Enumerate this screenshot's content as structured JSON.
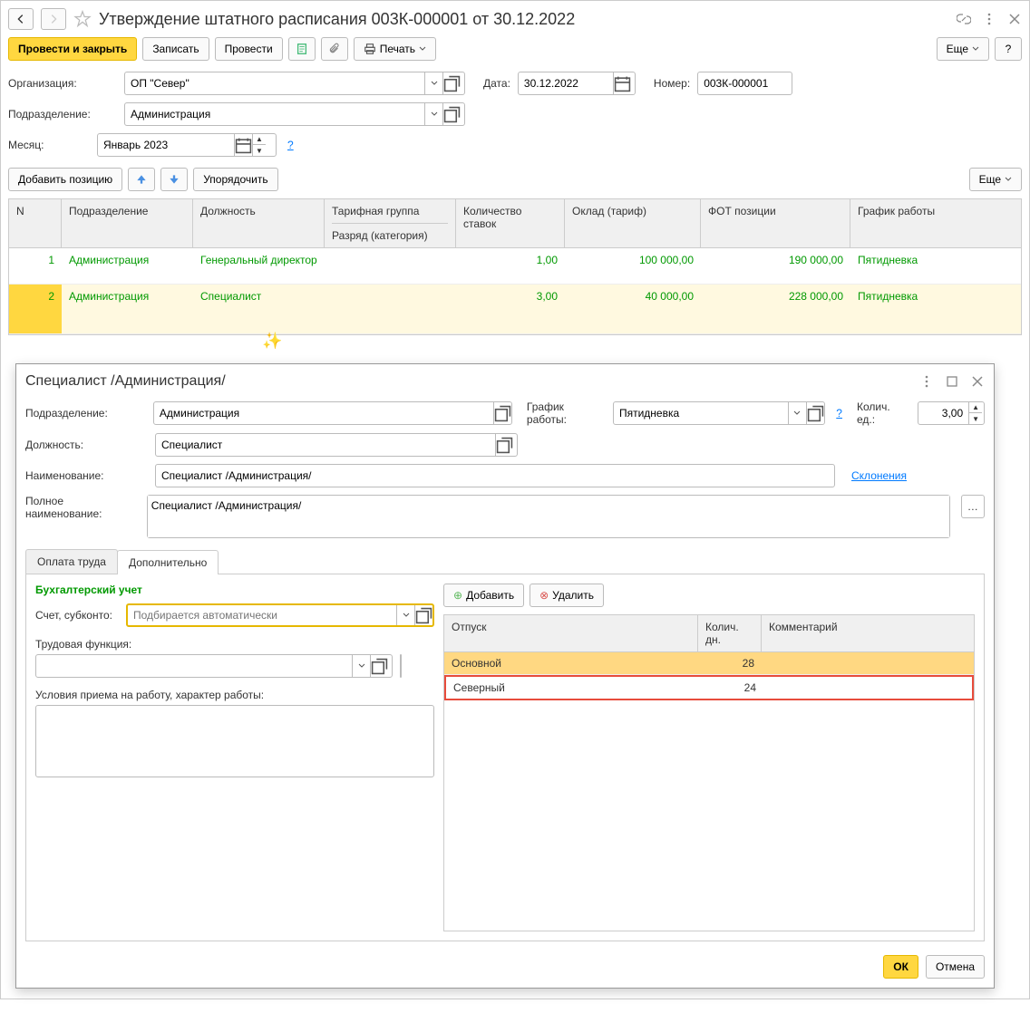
{
  "header": {
    "title": "Утверждение штатного расписания 003К-000001 от 30.12.2022"
  },
  "toolbar": {
    "post_and_close": "Провести и закрыть",
    "save": "Записать",
    "post": "Провести",
    "print": "Печать",
    "more": "Еще",
    "help": "?"
  },
  "form": {
    "org_label": "Организация:",
    "org_value": "ОП \"Север\"",
    "date_label": "Дата:",
    "date_value": "30.12.2022",
    "number_label": "Номер:",
    "number_value": "003К-000001",
    "dept_label": "Подразделение:",
    "dept_value": "Администрация",
    "month_label": "Месяц:",
    "month_value": "Январь 2023"
  },
  "positions_toolbar": {
    "add_position": "Добавить позицию",
    "sort": "Упорядочить",
    "more": "Еще"
  },
  "table_headers": {
    "n": "N",
    "dept": "Подразделение",
    "position": "Должность",
    "tariff_group": "Тарифная группа",
    "rank": "Разряд (категория)",
    "qty": "Количество ставок",
    "salary": "Оклад (тариф)",
    "fot": "ФОТ позиции",
    "schedule": "График работы"
  },
  "rows": [
    {
      "n": "1",
      "dept": "Администрация",
      "position": "Генеральный директор",
      "qty": "1,00",
      "salary": "100 000,00",
      "fot": "190 000,00",
      "schedule": "Пятидневка"
    },
    {
      "n": "2",
      "dept": "Администрация",
      "position": "Специалист",
      "qty": "3,00",
      "salary": "40 000,00",
      "fot": "228 000,00",
      "schedule": "Пятидневка"
    }
  ],
  "inner": {
    "title": "Специалист /Администрация/",
    "dept_label": "Подразделение:",
    "dept_value": "Администрация",
    "schedule_label": "График работы:",
    "schedule_value": "Пятидневка",
    "qty_label": "Колич. ед.:",
    "qty_value": "3,00",
    "position_label": "Должность:",
    "position_value": "Специалист",
    "name_label": "Наименование:",
    "name_value": "Специалист /Администрация/",
    "declension_link": "Склонения",
    "fullname_label": "Полное наименование:",
    "fullname_value": "Специалист /Администрация/",
    "tabs": {
      "pay": "Оплата труда",
      "additional": "Дополнительно"
    },
    "accounting_title": "Бухгалтерский учет",
    "account_label": "Счет, субконто:",
    "account_placeholder": "Подбирается автоматически",
    "labor_func_label": "Трудовая функция:",
    "conditions_label": "Условия приема на работу, характер работы:",
    "add_btn": "Добавить",
    "delete_btn": "Удалить",
    "vacation_headers": {
      "type": "Отпуск",
      "days": "Колич. дн.",
      "comment": "Комментарий"
    },
    "vacations": [
      {
        "type": "Основной",
        "days": "28",
        "comment": ""
      },
      {
        "type": "Северный",
        "days": "24",
        "comment": ""
      }
    ],
    "ok": "ОК",
    "cancel": "Отмена"
  }
}
